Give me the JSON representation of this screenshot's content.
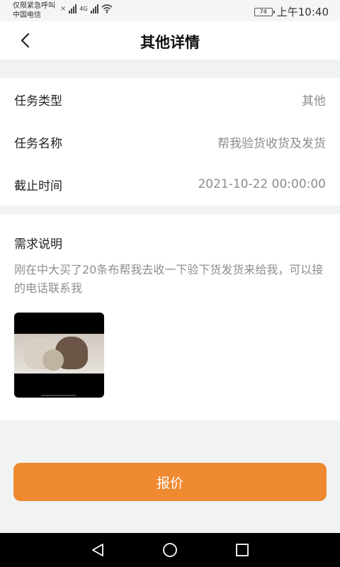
{
  "status_bar": {
    "carrier_line1": "仅限紧急呼叫",
    "carrier_line2": "中国电信",
    "network_type": "4G",
    "battery": "74",
    "time": "上午10:40"
  },
  "nav": {
    "title": "其他详情",
    "back_icon": "chevron-left-icon"
  },
  "info": [
    {
      "label": "任务类型",
      "value": "其他"
    },
    {
      "label": "任务名称",
      "value": "帮我验货收货及发货"
    },
    {
      "label": "截止时间",
      "value": "2021-10-22 00:00:00"
    }
  ],
  "description": {
    "title": "需求说明",
    "text": "刚在中大买了20条布帮我去收一下验下货发货来给我，可以接的电话联系我"
  },
  "action": {
    "quote_label": "报价",
    "color": "#ef8a30"
  },
  "system_nav": {
    "back_icon": "triangle-back-icon",
    "home_icon": "circle-home-icon",
    "recents_icon": "square-recents-icon"
  }
}
